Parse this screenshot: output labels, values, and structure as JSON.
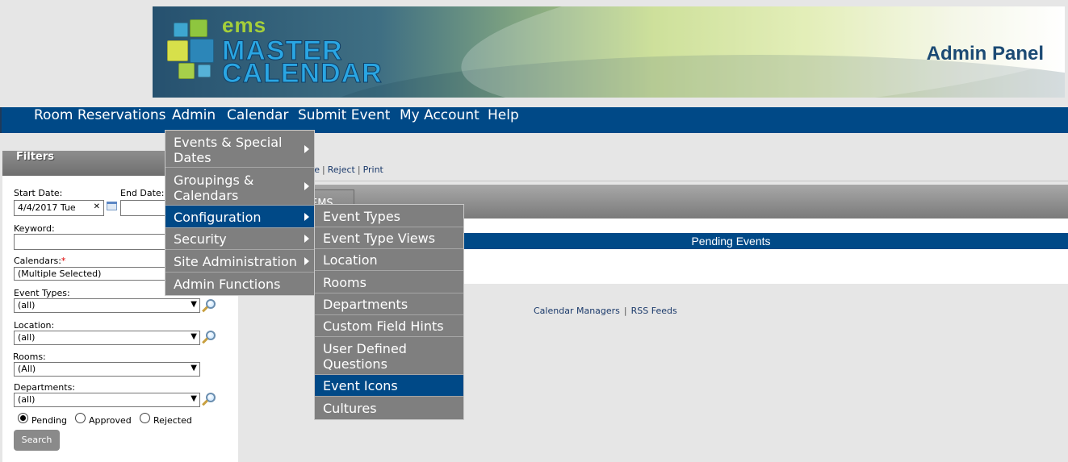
{
  "header": {
    "logo_small": "ems",
    "logo_line1": "MASTER",
    "logo_line2": "CALENDAR",
    "panel_title": "Admin Panel"
  },
  "nav": {
    "items": [
      "Room Reservations",
      "Admin",
      "Calendar",
      "Submit Event",
      "My Account",
      "Help"
    ]
  },
  "admin_menu": {
    "items": [
      {
        "label": "Events & Special Dates",
        "has_submenu": true
      },
      {
        "label": "Groupings & Calendars",
        "has_submenu": true
      },
      {
        "label": "Configuration",
        "has_submenu": true,
        "active": true
      },
      {
        "label": "Security",
        "has_submenu": true
      },
      {
        "label": "Site Administration",
        "has_submenu": true
      },
      {
        "label": "Admin Functions",
        "has_submenu": false
      }
    ]
  },
  "config_menu": {
    "items": [
      {
        "label": "Event Types"
      },
      {
        "label": "Event Type Views"
      },
      {
        "label": "Location"
      },
      {
        "label": "Rooms"
      },
      {
        "label": "Departments"
      },
      {
        "label": "Custom Field Hints"
      },
      {
        "label": "User Defined Questions"
      },
      {
        "label": "Event Icons",
        "active": true
      },
      {
        "label": "Cultures"
      }
    ]
  },
  "filters": {
    "title": "Filters",
    "start_date_label": "Start Date:",
    "start_date_value": "4/4/2017 Tue",
    "clear_glyph": "✕",
    "end_date_label": "End Date:",
    "end_date_value": "",
    "keyword_label": "Keyword:",
    "keyword_value": "",
    "calendars_label": "Calendars:",
    "required_mark": "*",
    "calendars_value": "(Multiple Selected)",
    "event_types_label": "Event Types:",
    "event_types_value": "(all)",
    "location_label": "Location:",
    "location_value": "(all)",
    "rooms_label": "Rooms:",
    "rooms_value": "(All)",
    "departments_label": "Departments:",
    "departments_value": "(all)",
    "status_options": [
      "Pending",
      "Approved",
      "Rejected"
    ],
    "status_selected": "Pending",
    "search_label": "Search"
  },
  "main": {
    "action_partial": "ove",
    "action_links": [
      "Reject",
      "Print"
    ],
    "link_separator": "|",
    "tab_partial": "EMS",
    "pending_title": "Pending Events",
    "footer_links": [
      "Calendar Managers",
      "RSS Feeds"
    ]
  },
  "colors": {
    "nav_blue": "#004987",
    "menu_gray": "#7f7f7f",
    "active_blue": "#004987"
  }
}
